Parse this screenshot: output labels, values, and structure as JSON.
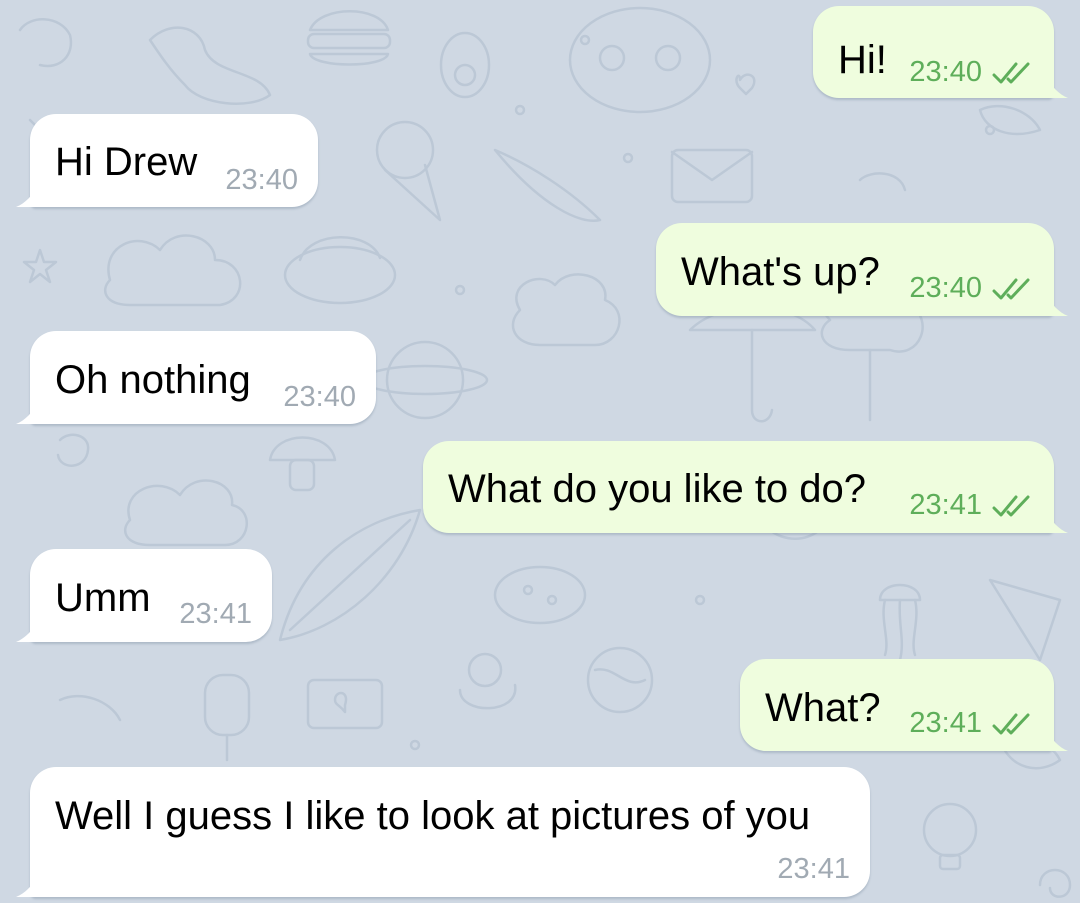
{
  "theme": {
    "background": "#cfd8e3",
    "incoming_bubble": "#ffffff",
    "outgoing_bubble": "#effdde",
    "outgoing_meta": "#5eae5a",
    "incoming_meta": "#a1aab3"
  },
  "messages": [
    {
      "direction": "out",
      "text": "Hi!",
      "time": "23:40",
      "status_icon": "double-check-icon"
    },
    {
      "direction": "in",
      "text": "Hi Drew",
      "time": "23:40"
    },
    {
      "direction": "out",
      "text": "What's up?",
      "time": "23:40",
      "status_icon": "double-check-icon"
    },
    {
      "direction": "in",
      "text": "Oh nothing",
      "time": "23:40"
    },
    {
      "direction": "out",
      "text": "What do you like to do?",
      "time": "23:41",
      "status_icon": "double-check-icon"
    },
    {
      "direction": "in",
      "text": "Umm",
      "time": "23:41"
    },
    {
      "direction": "out",
      "text": "What?",
      "time": "23:41",
      "status_icon": "double-check-icon"
    },
    {
      "direction": "in",
      "text": "Well I guess I like to look at pictures of you",
      "time": "23:41"
    }
  ]
}
